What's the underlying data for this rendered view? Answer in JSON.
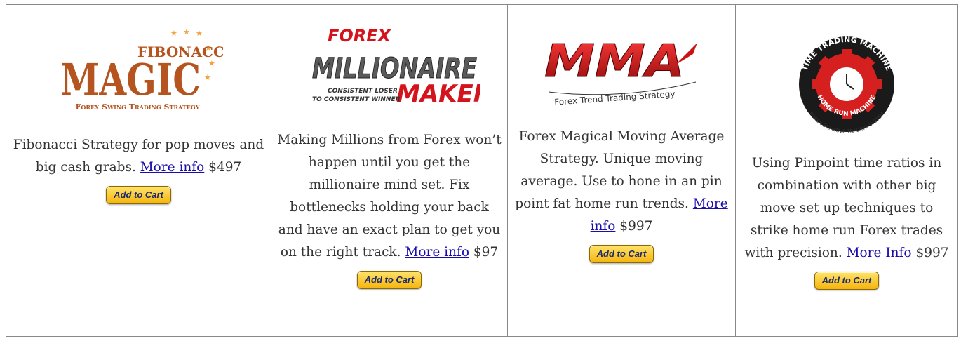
{
  "products": [
    {
      "logo": {
        "top": "FIBONACCI",
        "main": "MAGIC",
        "sub": "Forex Swing Trading Strategy"
      },
      "desc_before": "Fibonacci Strategy for pop moves and big cash grabs. ",
      "more_label": "More info",
      "price": " $497",
      "cart_label": "Add to Cart"
    },
    {
      "logo": {
        "line1": "FOREX",
        "line2": "MILLIONAIRE",
        "line3": "MAKER",
        "tag1": "CONSISTENT LOSER",
        "tag2": "TO CONSISTENT WINNER"
      },
      "desc_before": "Making Millions from Forex won’t happen until you get the millionaire mind set. Fix bottlenecks holding your back and have an exact plan to get you on the right track. ",
      "more_label": "More info",
      "price": "  $97",
      "cart_label": "Add to Cart"
    },
    {
      "logo": {
        "main": "MMA",
        "sub": "Forex Trend Trading Strategy"
      },
      "desc_before": "Forex Magical Moving Average Strategy. Unique moving average. Use to hone in an pin point fat home run trends.  ",
      "more_label": "More info",
      "price": " $997",
      "cart_label": "Add to Cart"
    },
    {
      "logo": {
        "top": "TIME TRADING MACHINE",
        "mid": "HOME RUN MACHINE",
        "bottom": "FOREX BIG MOVE TRADING SYSTEM"
      },
      "desc_before": "Using Pinpoint time ratios in combination with other big move set up techniques to strike home run Forex trades with precision.  ",
      "more_label": "More Info",
      "price": " $997",
      "cart_label": "Add to Cart"
    }
  ]
}
